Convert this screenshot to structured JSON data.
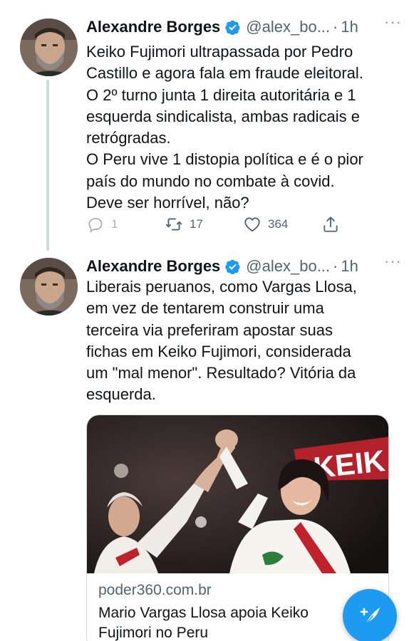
{
  "tweets": [
    {
      "author_name": "Alexandre Borges",
      "handle": "@alex_bo...",
      "separator": "·",
      "time": "1h",
      "more": "···",
      "lines": [
        "Keiko Fujimori ultrapassada por Pedro",
        "Castillo e agora fala em fraude eleitoral.",
        "O 2º turno junta 1 direita autoritária e 1",
        "esquerda sindicalista, ambas radicais e",
        "retrógradas.",
        "O Peru vive 1 distopia política e é o pior",
        "país do mundo no combate à covid.",
        "Deve ser horrível, não?"
      ],
      "replies": "1",
      "retweets": "17",
      "likes": "364"
    },
    {
      "author_name": "Alexandre Borges",
      "handle": "@alex_bo...",
      "separator": "·",
      "time": "1h",
      "more": "···",
      "lines": [
        "Liberais peruanos, como Vargas Llosa,",
        "em vez de tentarem construir uma",
        "terceira via preferiram apostar suas",
        "fichas em Keiko Fujimori, considerada",
        "um \"mal menor\". Resultado? Vitória da",
        "esquerda."
      ],
      "card": {
        "domain": "poder360.com.br",
        "title_lines": [
          "Mario Vargas Llosa apoia Keiko",
          "Fujimori no Peru"
        ],
        "image_sign_text": "KEIK"
      }
    }
  ],
  "icons": {
    "verified": "verified-badge-icon",
    "reply": "reply-icon",
    "retweet": "retweet-icon",
    "like": "heart-icon",
    "share": "share-icon",
    "compose": "compose-tweet-icon"
  },
  "colors": {
    "accent": "#1d9bf0",
    "text": "#0f1419",
    "secondary": "#536471",
    "like_dot": "#f91880"
  }
}
